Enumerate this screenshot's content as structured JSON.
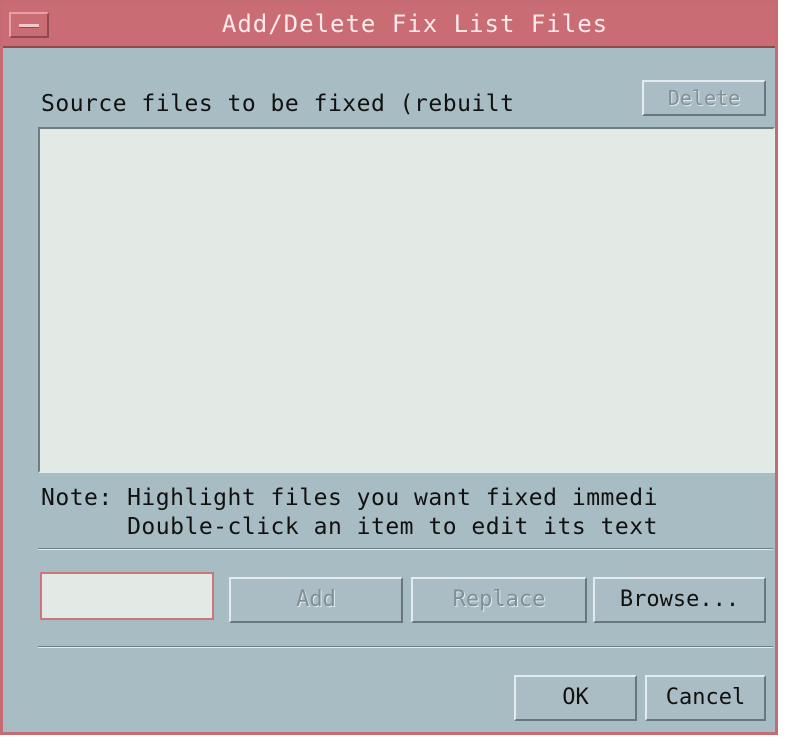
{
  "window": {
    "title": "Add/Delete Fix List Files"
  },
  "source_section": {
    "label": "Source files to be fixed (rebuilt",
    "delete_label": "Delete"
  },
  "file_list": {
    "items": []
  },
  "note": {
    "line1": "Note: Highlight files you want fixed immedi",
    "line2": "      Double-click an item to edit its text"
  },
  "entry": {
    "value": "",
    "add_label": "Add",
    "replace_label": "Replace",
    "browse_label": "Browse..."
  },
  "footer": {
    "ok_label": "OK",
    "cancel_label": "Cancel"
  },
  "colors": {
    "titlebar": "#c96c73",
    "window_bg": "#a8bcc3",
    "list_bg": "#e3eae6"
  }
}
